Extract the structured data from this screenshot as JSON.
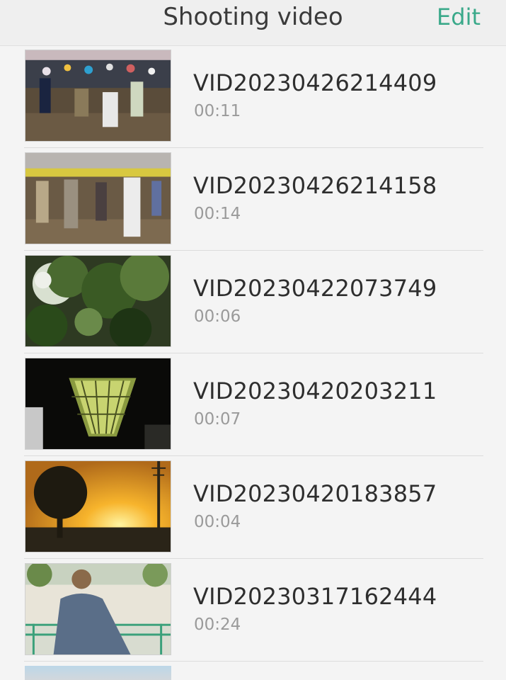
{
  "header": {
    "title": "Shooting video",
    "edit_label": "Edit",
    "accent_color": "#3aa98a"
  },
  "videos": [
    {
      "name": "VID20230426214409",
      "duration": "00:11"
    },
    {
      "name": "VID20230426214158",
      "duration": "00:14"
    },
    {
      "name": "VID20230422073749",
      "duration": "00:06"
    },
    {
      "name": "VID20230420203211",
      "duration": "00:07"
    },
    {
      "name": "VID20230420183857",
      "duration": "00:04"
    },
    {
      "name": "VID20230317162444",
      "duration": "00:24"
    }
  ]
}
